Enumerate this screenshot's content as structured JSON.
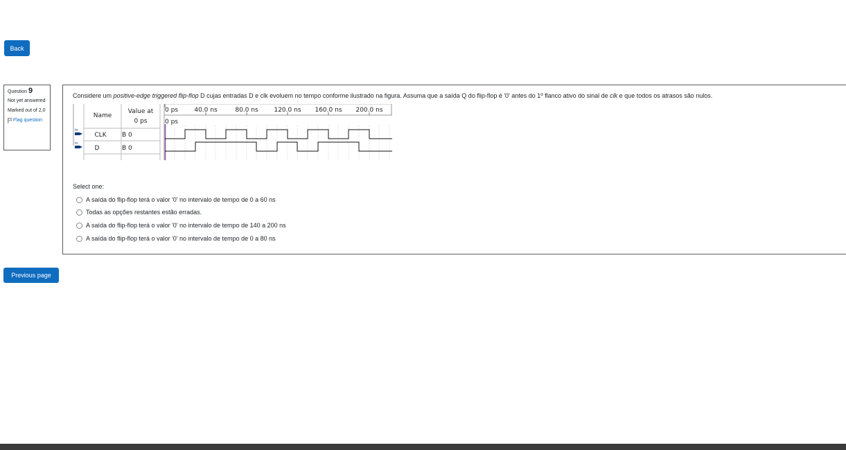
{
  "nav": {
    "back_label": "Back",
    "previous_label": "Previous page"
  },
  "question_info": {
    "question_prefix": "Question",
    "number": "9",
    "state": "Not yet answered",
    "grade": "Marked out of 2,0",
    "flag_label": "Flag question"
  },
  "question": {
    "text_before": "Considere um ",
    "text_italic1": "positive-edge triggered flip-flop",
    "text_mid": " D cujas entradas D e clk evoluem no tempo conforme ilustrado na figura. Assuma que a saída Q do flip-flop é '0' antes do 1º flanco ativo do sinal de ",
    "text_italic2": "clk",
    "text_after": " e que todos os atrasos são nulos."
  },
  "waveform": {
    "header_name": "Name",
    "header_value_line1": "Value at",
    "header_value_line2": "0 ps",
    "cursor_label": "0 ps",
    "time_ticks": [
      "0 ps",
      "40.0 ns",
      "80.0 ns",
      "120.0 ns",
      "160.0 ns",
      "200.0 ns"
    ],
    "pin_label": "in",
    "signals": [
      {
        "name": "CLK",
        "value": "B 0"
      },
      {
        "name": "D",
        "value": "B 0"
      }
    ]
  },
  "answer": {
    "prompt": "Select one:",
    "options": [
      "A saída do flip-flop terá o valor '0' no intervalo de tempo de 0 a 60 ns",
      "Todas as opções restantes estão erradas.",
      "A saída do flip-flop terá o valor '0' no intervalo de tempo de 140 a 200 ns",
      "A saída do flip-flop terá o valor '0' no intervalo de tempo de 0 a 80 ns"
    ]
  },
  "colors": {
    "primary": "#0f6cbf",
    "footer": "#3b3b3b",
    "cursor": "#8a5ab0"
  }
}
